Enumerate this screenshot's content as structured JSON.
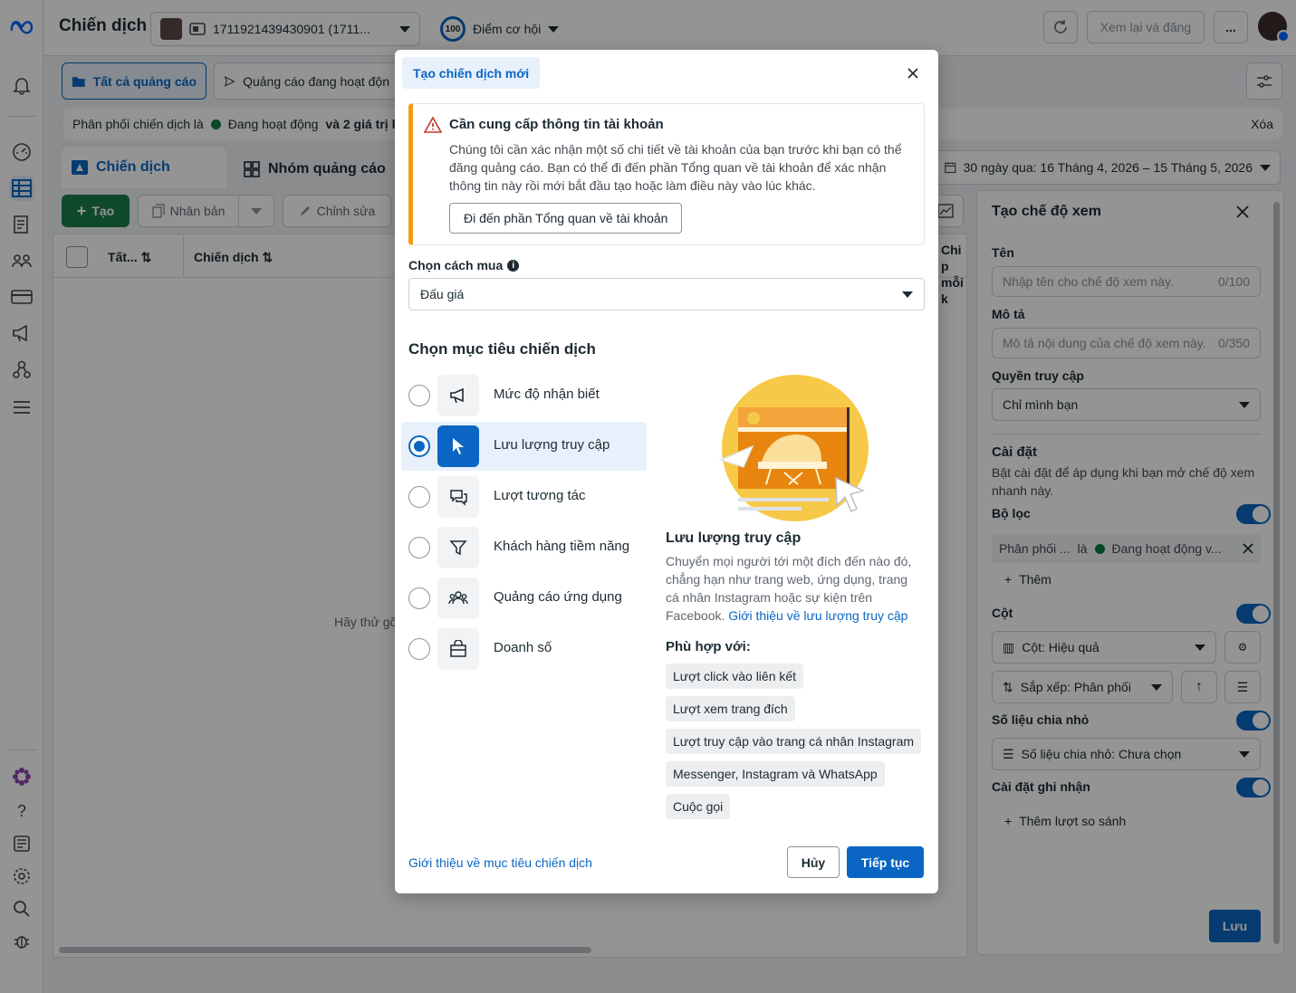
{
  "app": {
    "page_title": "Chiến dịch",
    "account_id": "1711921439430901 (1711...",
    "opportunity_score": "100",
    "opportunity_label": "Điểm cơ hội",
    "review_publish": "Xem lại và đăng",
    "more": "..."
  },
  "filters": {
    "tab_all": "Tất cả quảng cáo",
    "tab_active": "Quảng cáo đang hoạt độn",
    "filter_prefix": "Phân phối chiến dịch là",
    "filter_status": "Đang hoạt động",
    "filter_suffix": "và 2 giá trị k",
    "clear": "Xóa",
    "date_range": "30 ngày qua: 16 Tháng 4, 2026 – 15 Tháng 5, 2026"
  },
  "level_tabs": {
    "campaigns": "Chiến dịch",
    "ad_sets": "Nhóm quảng cáo"
  },
  "toolbar": {
    "create": "Tạo",
    "duplicate": "Nhân bản",
    "edit": "Chỉnh sửa"
  },
  "table": {
    "col_all": "Tất...",
    "col_campaign": "Chiến dịch",
    "col_cost_1": "Chi p",
    "col_cost_2": "mỗi k",
    "empty_hint": "Hãy thử gỡ"
  },
  "view_panel": {
    "title": "Tạo chế độ xem",
    "name_label": "Tên",
    "name_placeholder": "Nhập tên cho chế độ xem này.",
    "name_counter": "0/100",
    "desc_label": "Mô tả",
    "desc_placeholder": "Mô tả nội dung của chế độ xem này.",
    "desc_counter": "0/350",
    "access_label": "Quyền truy cập",
    "access_value": "Chỉ mình bạn",
    "settings_label": "Cài đặt",
    "settings_desc": "Bật cài đặt để áp dụng khi bạn mở chế độ xem nhanh này.",
    "filter_label": "Bộ lọc",
    "filter_chip_a": "Phân phối ...",
    "filter_chip_b": "là",
    "filter_chip_c": "Đang hoạt động v...",
    "add": "Thêm",
    "columns_label": "Cột",
    "columns_value": "Cột: Hiệu quả",
    "sort_value": "Sắp xếp: Phân phối",
    "breakdown_label": "Số liệu chia nhỏ",
    "breakdown_value": "Số liệu chia nhỏ: Chưa chọn",
    "attribution_label": "Cài đặt ghi nhận",
    "add_compare": "Thêm lượt so sánh",
    "save": "Lưu"
  },
  "modal": {
    "tab": "Tạo chiến dịch mới",
    "warning_title": "Cần cung cấp thông tin tài khoản",
    "warning_text": "Chúng tôi cần xác nhận một số chi tiết về tài khoản của bạn trước khi bạn có thể đăng quảng cáo. Bạn có thể đi đến phần Tổng quan về tài khoản để xác nhận thông tin này rồi mới bắt đầu tạo hoặc làm điều này vào lúc khác.",
    "warning_button": "Đi đến phần Tổng quan về tài khoản",
    "buy_label": "Chọn cách mua",
    "buy_value": "Đấu giá",
    "objective_heading": "Chọn mục tiêu chiến dịch",
    "objectives": [
      {
        "label": "Mức độ nhận biết",
        "icon": "megaphone-icon",
        "selected": false
      },
      {
        "label": "Lưu lượng truy cập",
        "icon": "cursor-icon",
        "selected": true
      },
      {
        "label": "Lượt tương tác",
        "icon": "chat-bubbles-icon",
        "selected": false
      },
      {
        "label": "Khách hàng tiềm năng",
        "icon": "funnel-icon",
        "selected": false
      },
      {
        "label": "Quảng cáo ứng dụng",
        "icon": "people-icon",
        "selected": false
      },
      {
        "label": "Doanh số",
        "icon": "shopping-bag-icon",
        "selected": false
      }
    ],
    "detail_title": "Lưu lượng truy cập",
    "detail_text": "Chuyển mọi người tới một đích đến nào đó, chẳng hạn như trang web, ứng dụng, trang cá nhân Instagram hoặc sự kiện trên Facebook.",
    "detail_link": "Giới thiệu về lưu lượng truy cập",
    "fit_title": "Phù hợp với:",
    "fit_chips": [
      "Lượt click vào liên kết",
      "Lượt xem trang đích",
      "Lượt truy cập vào trang cá nhân Instagram",
      "Messenger, Instagram và WhatsApp",
      "Cuộc gọi"
    ],
    "footer_link": "Giới thiệu về mục tiêu chiến dịch",
    "cancel": "Hủy",
    "continue": "Tiếp tục"
  },
  "colors": {
    "accent": "#0a66c2",
    "warning": "#f39c12",
    "status_active": "#0d7a3e"
  }
}
